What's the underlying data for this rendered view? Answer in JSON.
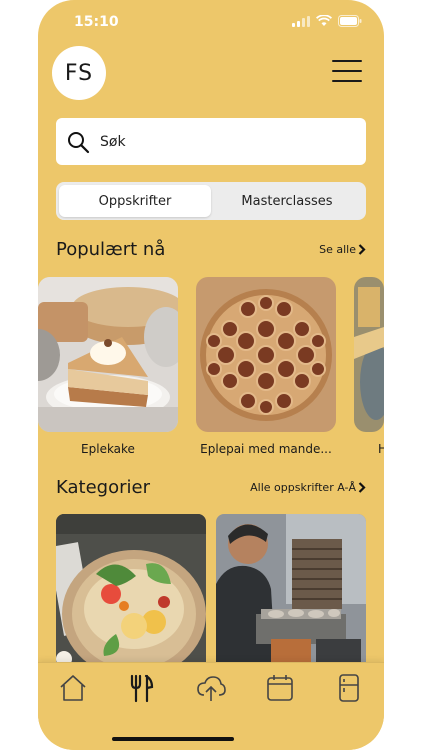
{
  "status": {
    "time": "15:10"
  },
  "logo": {
    "text": "FS"
  },
  "search": {
    "placeholder": "Søk"
  },
  "tabs": [
    {
      "label": "Oppskrifter",
      "active": true
    },
    {
      "label": "Masterclasses",
      "active": false
    }
  ],
  "popular": {
    "title": "Populært nå",
    "see_all": "Se alle",
    "items": [
      {
        "label": "Eplekake"
      },
      {
        "label": "Eplepai med mande..."
      },
      {
        "label": "H"
      }
    ]
  },
  "categories": {
    "title": "Kategorier",
    "link": "Alle oppskrifter A-Å"
  },
  "tabbar": {
    "items": [
      "home-icon",
      "cutlery-icon",
      "upload-cloud-icon",
      "calendar-icon",
      "fridge-icon"
    ]
  },
  "colors": {
    "background": "#EDC76A",
    "surface": "#FFFFFF",
    "text": "#1A1A1A"
  }
}
